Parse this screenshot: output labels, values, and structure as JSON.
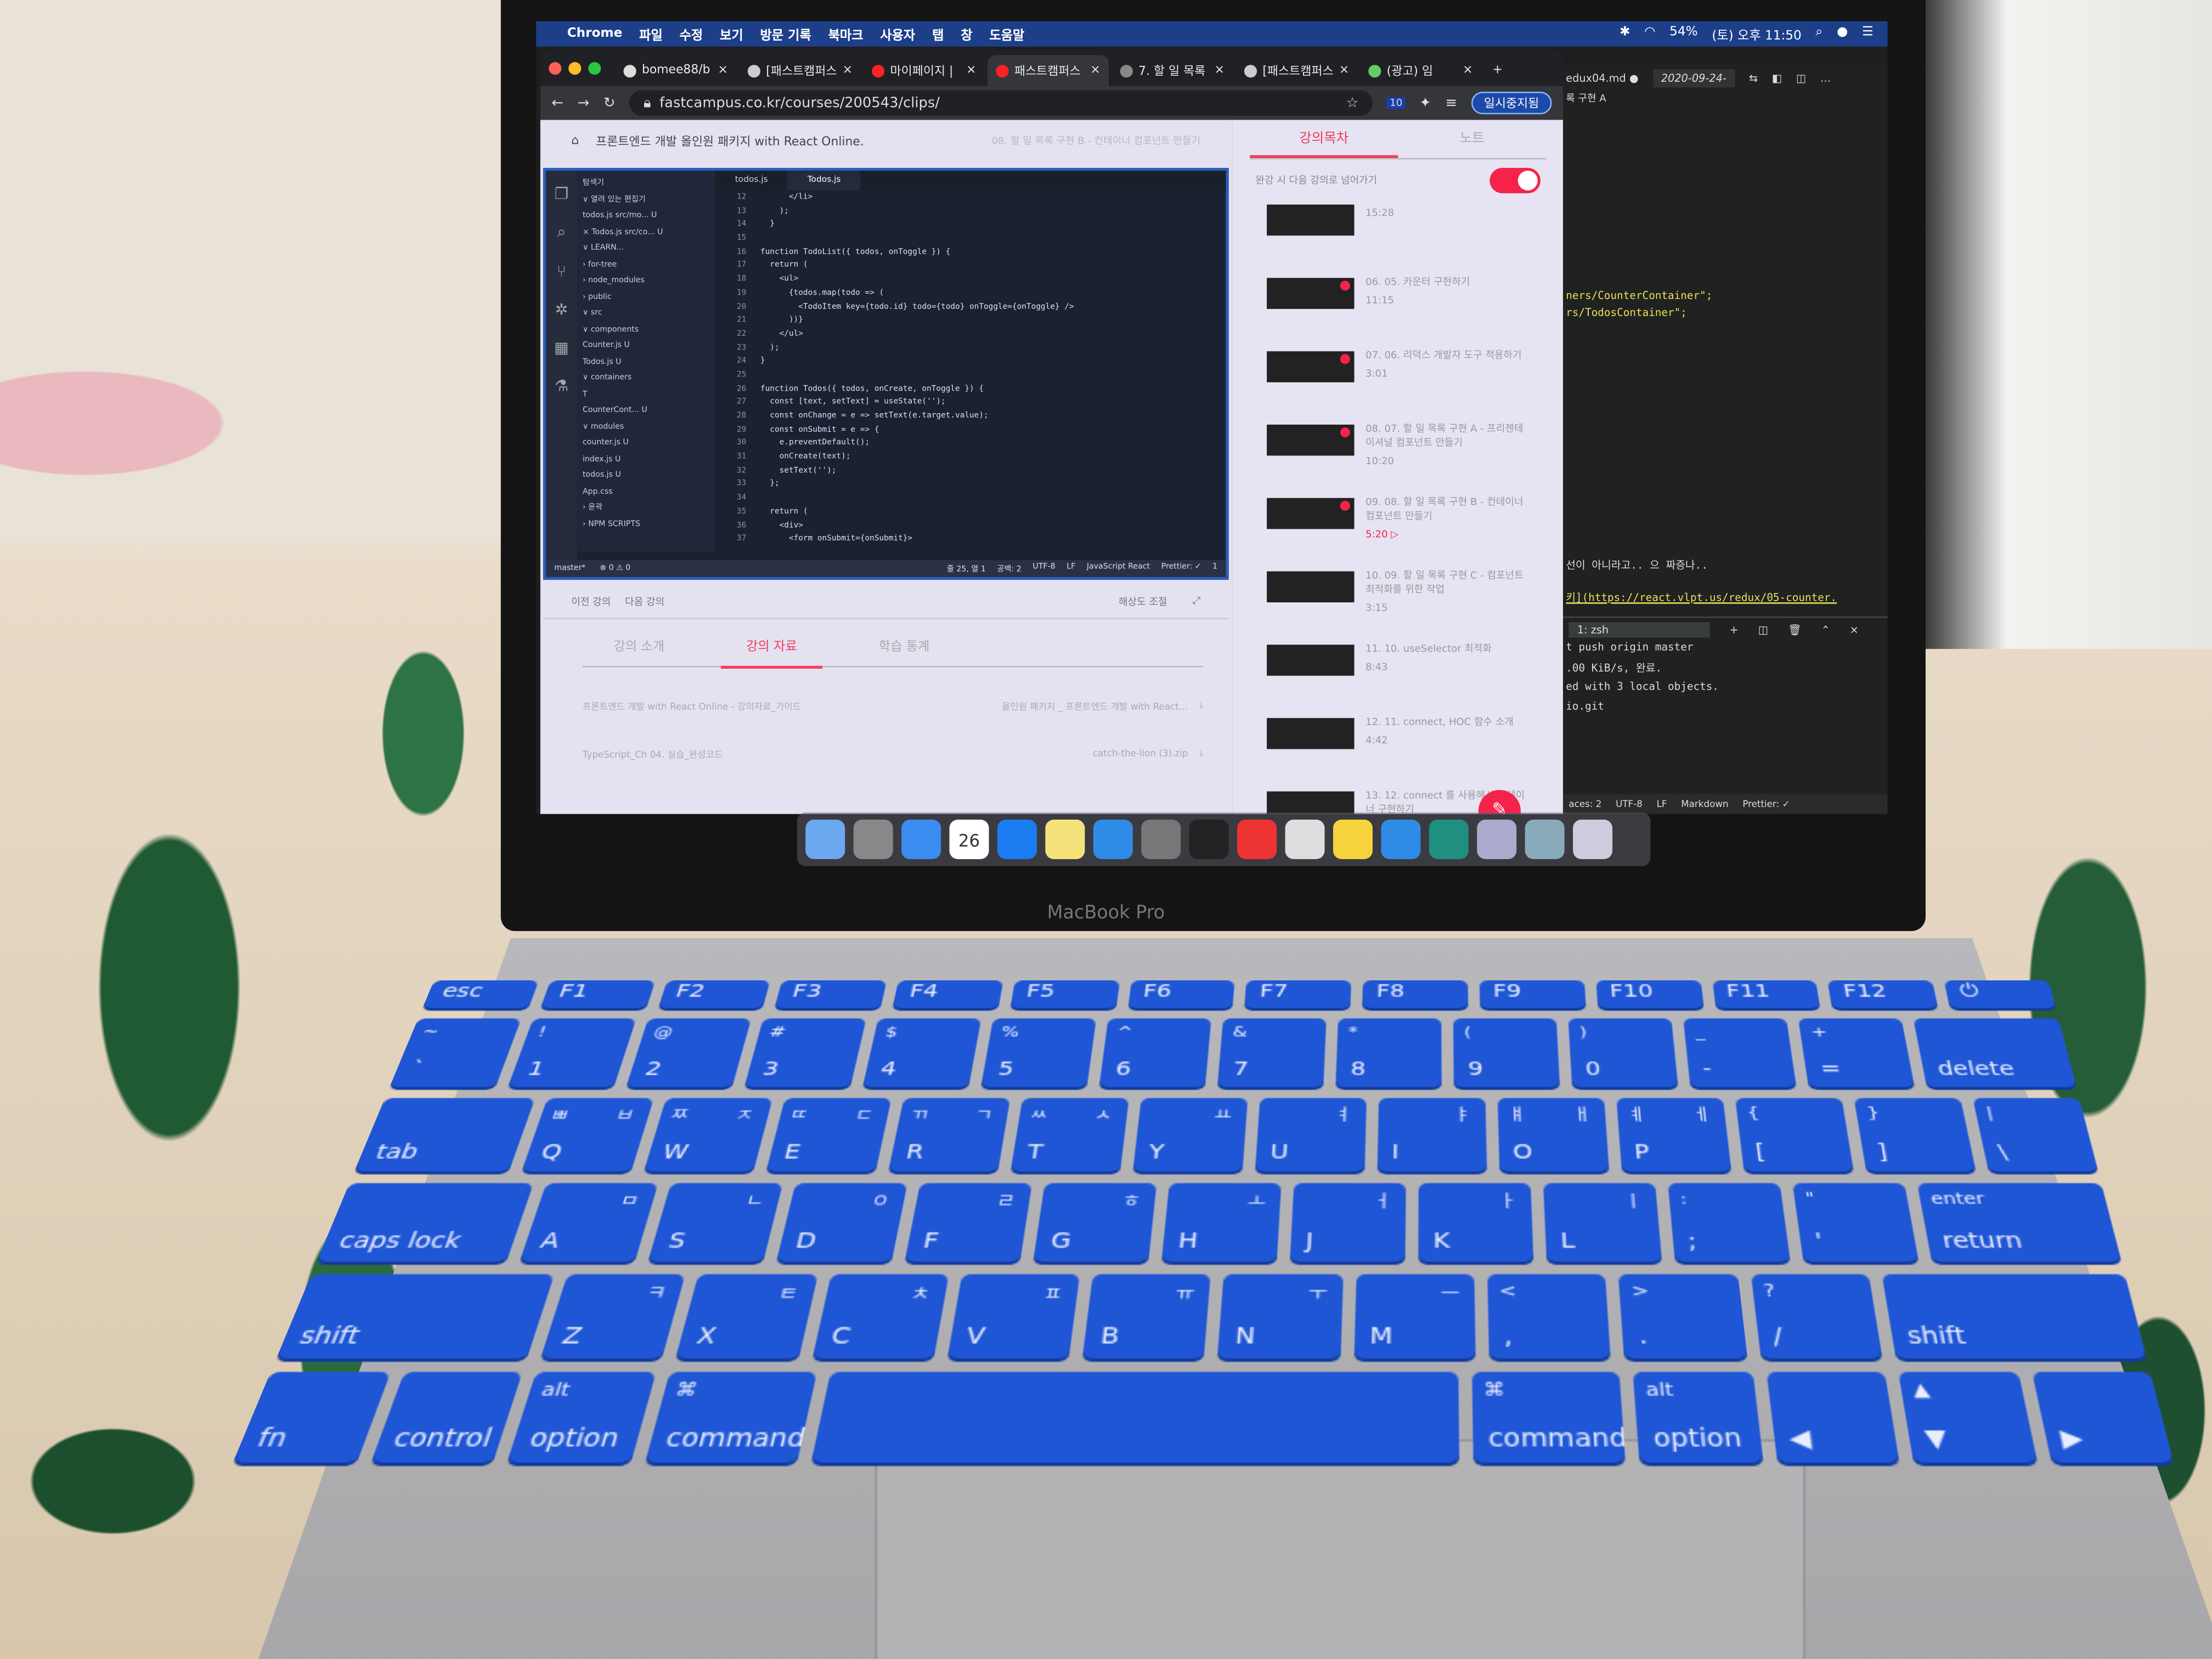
{
  "menubar": {
    "app": "Chrome",
    "items": [
      "파일",
      "수정",
      "보기",
      "방문 기록",
      "북마크",
      "사용자",
      "탭",
      "창",
      "도움말"
    ],
    "battery": "54%",
    "clock": "(토) 오후 11:50"
  },
  "browser": {
    "tabs": [
      {
        "label": "bomee88/b"
      },
      {
        "label": "[패스트캠퍼스"
      },
      {
        "label": "마이페이지 |"
      },
      {
        "label": "패스트캠퍼스",
        "active": true
      },
      {
        "label": "7. 할 일 목록"
      },
      {
        "label": "[패스트캠퍼스"
      },
      {
        "label": "(광고) 임"
      }
    ],
    "url": "fastcampus.co.kr/courses/200543/clips/",
    "extension_badge": "10",
    "profile": "일시중지됨"
  },
  "page": {
    "course_title": "프론트엔드 개발 올인원 패키지 with React Online.",
    "clip_title": "08. 할 일 목록 구현 B - 컨테이너 컴포넌트 만들기",
    "controls": {
      "prev": "이전 강의",
      "next": "다음 강의",
      "resolution": "해상도 조절"
    },
    "tabs": [
      {
        "label": "강의 소개"
      },
      {
        "label": "강의 자료",
        "active": true
      },
      {
        "label": "학습 통계"
      }
    ],
    "files": [
      {
        "left": "프론트엔드 개발 with React Online - 강의자료_가이드",
        "right": "올인원 패키지 _ 프론트엔드 개발 with React…"
      },
      {
        "left": "TypeScript_Ch 04. 실습_완성코드",
        "right": "catch-the-lion (3).zip"
      }
    ],
    "sidebar": {
      "tabs": [
        {
          "label": "강의목차",
          "active": true
        },
        {
          "label": "노트"
        }
      ],
      "autoplay_label": "완강 시 다음 강의로 넘어가기",
      "autoplay_on": true,
      "lessons": [
        {
          "title": "",
          "duration": "15:28",
          "done": false
        },
        {
          "title": "06. 05. 카운터 구현하기",
          "duration": "11:15",
          "done": true
        },
        {
          "title": "07. 06. 리덕스 개발자 도구 적용하기",
          "duration": "3:01",
          "done": true
        },
        {
          "title": "08. 07. 할 일 목록 구현 A - 프리젠테이셔널 컴포넌트 만들기",
          "duration": "10:20",
          "done": true
        },
        {
          "title": "09. 08. 할 일 목록 구현 B - 컨테이너 컴포넌트 만들기",
          "duration": "5:20",
          "done": true,
          "current": true
        },
        {
          "title": "10. 09. 할 일 목록 구현 C - 컴포넌트 최적화를 위한 작업",
          "duration": "3:15",
          "done": false
        },
        {
          "title": "11. 10. useSelector 최적화",
          "duration": "8:43",
          "done": false
        },
        {
          "title": "12. 11. connect, HOC 함수 소개",
          "duration": "4:42",
          "done": false
        },
        {
          "title": "13. 12. connect 를 사용해서 컨테이너 구현하기",
          "duration": "",
          "done": false
        }
      ]
    }
  },
  "video_editor": {
    "explorer_title": "탐색기",
    "tabs": [
      "todos.js",
      "Todos.js"
    ],
    "tree": [
      "∨ 열려 있는 편집기",
      "todos.js src/mo... U",
      "× Todos.js src/co... U",
      "∨ LEARN...",
      "› for-tree",
      "› node_modules",
      "› public",
      "∨ src",
      "∨ components",
      "Counter.js U",
      "Todos.js U",
      "∨ containers",
      "T",
      "CounterCont... U",
      "∨ modules",
      "counter.js U",
      "index.js U",
      "todos.js U",
      "App.css",
      "› 윤곽",
      "› NPM SCRIPTS"
    ],
    "code": [
      [
        "12",
        "      </li>"
      ],
      [
        "13",
        "    );"
      ],
      [
        "14",
        "  }"
      ],
      [
        "15",
        ""
      ],
      [
        "16",
        "function TodoList({ todos, onToggle }) {"
      ],
      [
        "17",
        "  return ("
      ],
      [
        "18",
        "    <ul>"
      ],
      [
        "19",
        "      {todos.map(todo => ("
      ],
      [
        "20",
        "        <TodoItem key={todo.id} todo={todo} onToggle={onToggle} />"
      ],
      [
        "21",
        "      ))}"
      ],
      [
        "22",
        "    </ul>"
      ],
      [
        "23",
        "  );"
      ],
      [
        "24",
        "}"
      ],
      [
        "25",
        ""
      ],
      [
        "26",
        "function Todos({ todos, onCreate, onToggle }) {"
      ],
      [
        "27",
        "  const [text, setText] = useState('');"
      ],
      [
        "28",
        "  const onChange = e => setText(e.target.value);"
      ],
      [
        "29",
        "  const onSubmit = e => {"
      ],
      [
        "30",
        "    e.preventDefault();"
      ],
      [
        "31",
        "    onCreate(text);"
      ],
      [
        "32",
        "    setText('');"
      ],
      [
        "33",
        "  };"
      ],
      [
        "34",
        ""
      ],
      [
        "35",
        "  return ("
      ],
      [
        "36",
        "    <div>"
      ],
      [
        "37",
        "      <form onSubmit={onSubmit}>"
      ]
    ],
    "status_left": [
      "master*",
      "⊗ 0 ⚠ 0"
    ],
    "status_right": [
      "줄 25, 열 1",
      "공백: 2",
      "UTF-8",
      "LF",
      "JavaScript React",
      "Prettier: ✓",
      "1"
    ]
  },
  "editor2": {
    "tabs": [
      "edux04.md ●",
      "2020-09-24-"
    ],
    "breadcrumb": "록 구현 A",
    "lines": [
      "ners/CounterContainer\";",
      "rs/TodosContainer\";",
      "선이 아니라고.. 으 짜증나..",
      "키](https://react.vlpt.us/redux/05-counter."
    ],
    "terminal_select": "1: zsh",
    "terminal": [
      "t push origin master",
      ".00 KiB/s, 완료.",
      "ed with 3 local objects.",
      "io.git"
    ],
    "status": [
      "aces: 2",
      "UTF-8",
      "LF",
      "Markdown",
      "Prettier: ✓"
    ]
  },
  "dock": {
    "apps": [
      "finder",
      "launchpad",
      "safari",
      "calendar",
      "app-store",
      "notes",
      "vscode",
      "system-preferences",
      "terminal",
      "chrome",
      "virtualbox",
      "kakaotalk",
      "vscode",
      "vscode-insiders",
      "preview",
      "downloads",
      "trash"
    ],
    "calendar_day": "26"
  },
  "laptop": {
    "model": "MacBook Pro"
  },
  "keyboard": {
    "color": "#1f56d6",
    "rows": [
      [
        {
          "b": "esc"
        },
        {
          "b": "F1"
        },
        {
          "b": "F2"
        },
        {
          "b": "F3"
        },
        {
          "b": "F4"
        },
        {
          "b": "F5"
        },
        {
          "b": "F6"
        },
        {
          "b": "F7"
        },
        {
          "b": "F8"
        },
        {
          "b": "F9"
        },
        {
          "b": "F10"
        },
        {
          "b": "F11"
        },
        {
          "b": "F12"
        },
        {
          "b": "⏻"
        }
      ],
      [
        {
          "t": "~",
          "b": "`"
        },
        {
          "t": "!",
          "b": "1"
        },
        {
          "t": "@",
          "b": "2"
        },
        {
          "t": "#",
          "b": "3"
        },
        {
          "t": "$",
          "b": "4"
        },
        {
          "t": "%",
          "b": "5"
        },
        {
          "t": "^",
          "b": "6"
        },
        {
          "t": "&",
          "b": "7"
        },
        {
          "t": "*",
          "b": "8"
        },
        {
          "t": "(",
          "b": "9"
        },
        {
          "t": ")",
          "b": "0"
        },
        {
          "t": "_",
          "b": "-"
        },
        {
          "t": "+",
          "b": "="
        },
        {
          "b": "delete",
          "w": "w15"
        }
      ],
      [
        {
          "b": "tab",
          "w": "w15"
        },
        {
          "t": "ㅃ",
          "k": "ㅂ",
          "b": "Q"
        },
        {
          "t": "ㅉ",
          "k": "ㅈ",
          "b": "W"
        },
        {
          "t": "ㄸ",
          "k": "ㄷ",
          "b": "E"
        },
        {
          "t": "ㄲ",
          "k": "ㄱ",
          "b": "R"
        },
        {
          "t": "ㅆ",
          "k": "ㅅ",
          "b": "T"
        },
        {
          "k": "ㅛ",
          "b": "Y"
        },
        {
          "k": "ㅕ",
          "b": "U"
        },
        {
          "k": "ㅑ",
          "b": "I"
        },
        {
          "t": "ㅒ",
          "k": "ㅐ",
          "b": "O"
        },
        {
          "t": "ㅖ",
          "k": "ㅔ",
          "b": "P"
        },
        {
          "t": "{",
          "b": "["
        },
        {
          "t": "}",
          "b": "]"
        },
        {
          "t": "|",
          "b": "\\"
        }
      ],
      [
        {
          "b": "caps lock",
          "w": "w18"
        },
        {
          "k": "ㅁ",
          "b": "A"
        },
        {
          "k": "ㄴ",
          "b": "S"
        },
        {
          "k": "ㅇ",
          "b": "D"
        },
        {
          "k": "ㄹ",
          "b": "F"
        },
        {
          "k": "ㅎ",
          "b": "G"
        },
        {
          "k": "ㅗ",
          "b": "H"
        },
        {
          "k": "ㅓ",
          "b": "J"
        },
        {
          "k": "ㅏ",
          "b": "K"
        },
        {
          "k": "ㅣ",
          "b": "L"
        },
        {
          "t": ":",
          "b": ";"
        },
        {
          "t": "\"",
          "b": "'"
        },
        {
          "t": "enter",
          "b": "return",
          "w": "w18"
        }
      ],
      [
        {
          "b": "shift",
          "w": "w22"
        },
        {
          "k": "ㅋ",
          "b": "Z"
        },
        {
          "k": "ㅌ",
          "b": "X"
        },
        {
          "k": "ㅊ",
          "b": "C"
        },
        {
          "k": "ㅍ",
          "b": "V"
        },
        {
          "k": "ㅠ",
          "b": "B"
        },
        {
          "k": "ㅜ",
          "b": "N"
        },
        {
          "k": "ㅡ",
          "b": "M"
        },
        {
          "t": "<",
          "b": ","
        },
        {
          "t": ">",
          "b": "."
        },
        {
          "t": "?",
          "b": "/"
        },
        {
          "b": "shift",
          "w": "w22"
        }
      ],
      [
        {
          "b": "fn"
        },
        {
          "b": "control"
        },
        {
          "t": "alt",
          "b": "option"
        },
        {
          "t": "⌘",
          "b": "command",
          "w": "w13"
        },
        {
          "b": "",
          "w": "w6"
        },
        {
          "t": "⌘",
          "b": "command",
          "w": "w13"
        },
        {
          "t": "alt",
          "b": "option"
        },
        {
          "b": "◀"
        },
        {
          "t": "▲",
          "b": "▼"
        },
        {
          "b": "▶"
        }
      ]
    ]
  }
}
